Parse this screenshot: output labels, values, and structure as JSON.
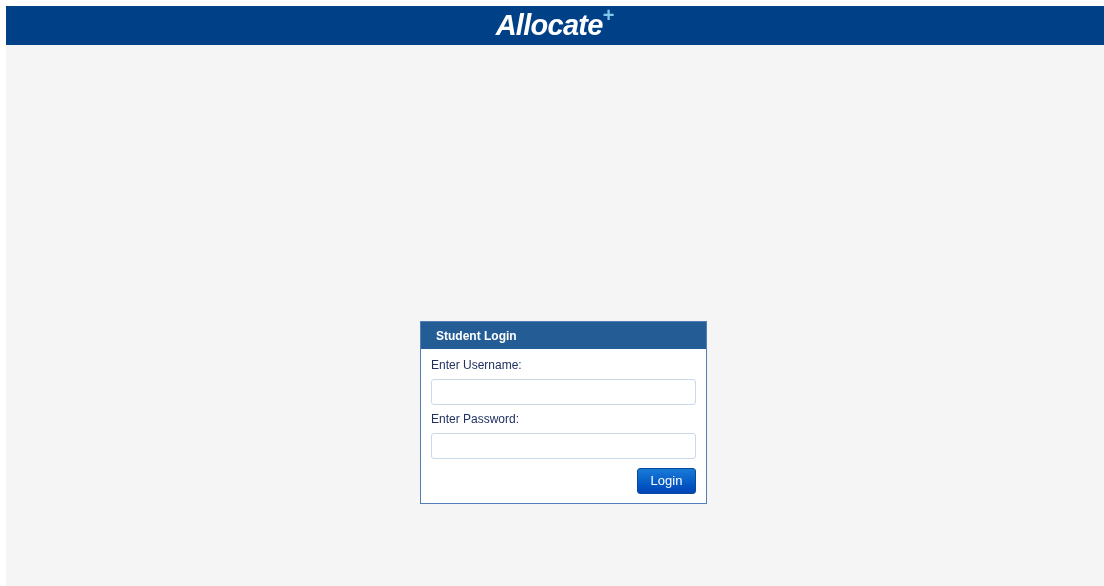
{
  "header": {
    "logo": "Allocate",
    "logo_mark": "+"
  },
  "login": {
    "title": "Student Login",
    "fields": [
      {
        "label": "Enter Username:"
      },
      {
        "label": "Enter Password:"
      }
    ],
    "button": "Login"
  }
}
